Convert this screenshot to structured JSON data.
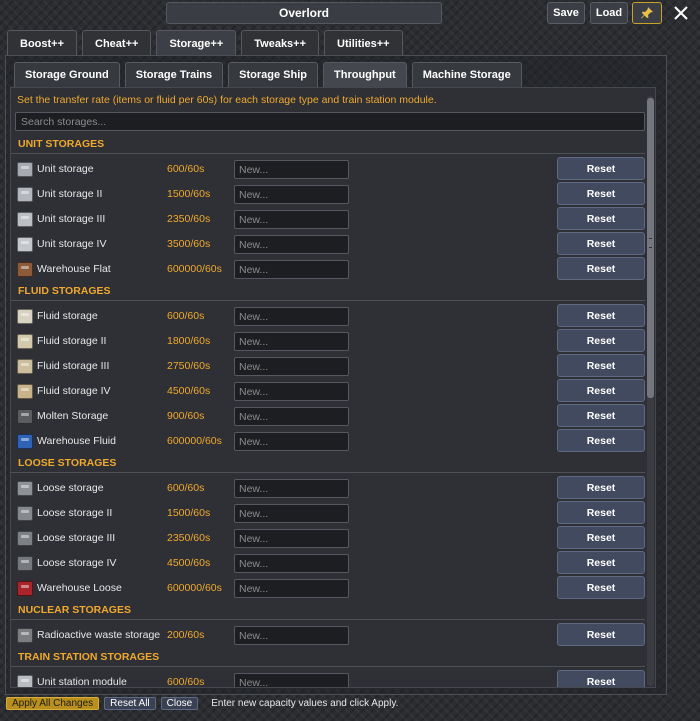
{
  "window": {
    "title": "Overlord",
    "save_label": "Save",
    "load_label": "Load",
    "pin_icon": "pin-icon",
    "close_icon": "close-icon",
    "accent_color": "#f0a92e"
  },
  "main_tabs": [
    {
      "label": "Boost++",
      "active": false
    },
    {
      "label": "Cheat++",
      "active": false
    },
    {
      "label": "Storage++",
      "active": true
    },
    {
      "label": "Tweaks++",
      "active": false
    },
    {
      "label": "Utilities++",
      "active": false
    }
  ],
  "sub_tabs": [
    {
      "label": "Storage Ground",
      "active": false
    },
    {
      "label": "Storage Trains",
      "active": false
    },
    {
      "label": "Storage Ship",
      "active": false
    },
    {
      "label": "Throughput",
      "active": true
    },
    {
      "label": "Machine Storage",
      "active": false
    }
  ],
  "description": "Set the transfer rate (items or fluid per 60s) for each storage type and train station module.",
  "search_placeholder": "Search storages...",
  "input_placeholder": "New...",
  "reset_label": "Reset",
  "sections": [
    {
      "title": "UNIT STORAGES",
      "rows": [
        {
          "name": "Unit storage",
          "rate": "600/60s",
          "icon": "unit-storage-icon",
          "color": "#a7abb1"
        },
        {
          "name": "Unit storage II",
          "rate": "1500/60s",
          "icon": "unit-storage-2-icon",
          "color": "#b3b7bd"
        },
        {
          "name": "Unit storage III",
          "rate": "2350/60s",
          "icon": "unit-storage-3-icon",
          "color": "#bcc0c5"
        },
        {
          "name": "Unit storage IV",
          "rate": "3500/60s",
          "icon": "unit-storage-4-icon",
          "color": "#c4c7cc"
        },
        {
          "name": "Warehouse Flat",
          "rate": "600000/60s",
          "icon": "warehouse-flat-icon",
          "color": "#8d5a3a"
        }
      ]
    },
    {
      "title": "FLUID STORAGES",
      "rows": [
        {
          "name": "Fluid storage",
          "rate": "600/60s",
          "icon": "fluid-storage-icon",
          "color": "#d8d2c3"
        },
        {
          "name": "Fluid storage II",
          "rate": "1800/60s",
          "icon": "fluid-storage-2-icon",
          "color": "#d4c9ad"
        },
        {
          "name": "Fluid storage III",
          "rate": "2750/60s",
          "icon": "fluid-storage-3-icon",
          "color": "#cdbf9d"
        },
        {
          "name": "Fluid storage IV",
          "rate": "4500/60s",
          "icon": "fluid-storage-4-icon",
          "color": "#c7b48a"
        },
        {
          "name": "Molten Storage",
          "rate": "900/60s",
          "icon": "molten-storage-icon",
          "color": "#5a5c60"
        },
        {
          "name": "Warehouse Fluid",
          "rate": "600000/60s",
          "icon": "warehouse-fluid-icon",
          "color": "#2f63b8"
        }
      ]
    },
    {
      "title": "LOOSE STORAGES",
      "rows": [
        {
          "name": "Loose storage",
          "rate": "600/60s",
          "icon": "loose-storage-icon",
          "color": "#8e9196"
        },
        {
          "name": "Loose storage II",
          "rate": "1500/60s",
          "icon": "loose-storage-2-icon",
          "color": "#85888d"
        },
        {
          "name": "Loose storage III",
          "rate": "2350/60s",
          "icon": "loose-storage-3-icon",
          "color": "#7d8085"
        },
        {
          "name": "Loose storage IV",
          "rate": "4500/60s",
          "icon": "loose-storage-4-icon",
          "color": "#75787d"
        },
        {
          "name": "Warehouse Loose",
          "rate": "600000/60s",
          "icon": "warehouse-loose-icon",
          "color": "#a8262b"
        }
      ]
    },
    {
      "title": "NUCLEAR STORAGES",
      "rows": [
        {
          "name": "Radioactive waste storage",
          "rate": "200/60s",
          "icon": "radioactive-waste-icon",
          "color": "#7b7d81"
        }
      ]
    },
    {
      "title": "TRAIN STATION STORAGES",
      "rows": [
        {
          "name": "Unit station module",
          "rate": "600/60s",
          "icon": "unit-station-module-icon",
          "color": "#b9bcc1"
        },
        {
          "name": "",
          "rate": "",
          "icon": "station-module-icon",
          "color": "#9fa2a7"
        }
      ]
    }
  ],
  "footer": {
    "apply_label": "Apply All Changes",
    "reset_all_label": "Reset All",
    "close_label": "Close",
    "hint": "Enter new capacity values and click Apply."
  }
}
